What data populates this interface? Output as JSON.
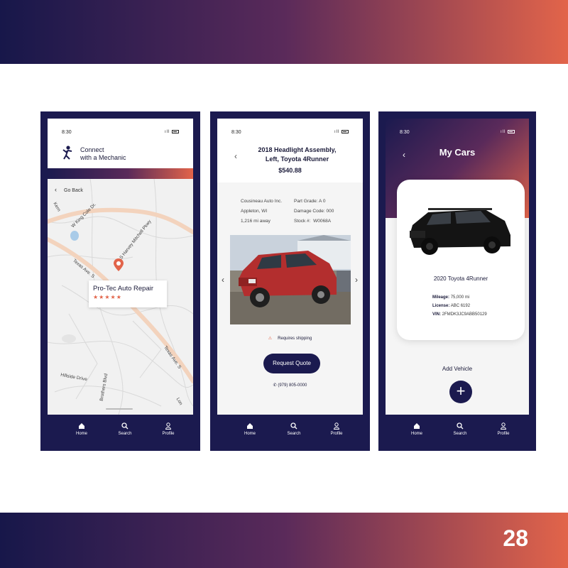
{
  "slide": {
    "page_number": "28"
  },
  "colors": {
    "navy": "#1b1a4f",
    "accent": "#e2644a",
    "star": "#e2644a"
  },
  "status_bar": {
    "time": "8:30"
  },
  "nav": {
    "home": "Home",
    "search": "Search",
    "profile": "Profile"
  },
  "screen1": {
    "title_line1": "Connect",
    "title_line2": "with a Mechanic",
    "go_back": "Go Back",
    "streets": [
      "W King Cole Dr.",
      "S Harvey Mitchell Pkwy",
      "Texas Ave. S",
      "Texas Ave. S",
      "Hillside Drive",
      "Brothers Blvd",
      "Kern",
      "Lon"
    ],
    "place_name": "Pro-Tec Auto Repair",
    "rating_stars": "★★★★★",
    "rating": 5
  },
  "screen2": {
    "title_line1": "2018 Headlight Assembly,",
    "title_line2": "Left, Toyota 4Runner",
    "price": "$540.88",
    "seller": "Cousineau Auto Inc.",
    "location": "Appleton, WI",
    "distance": "1,216 mi away",
    "part_grade": "Part Grade: A 0",
    "damage_code": "Damage Code: 000",
    "stock_label": "Stock #:",
    "stock_value": "W0068A",
    "shipping": "Requires shipping",
    "request_button": "Request Quote",
    "phone": "(979) 805-0000"
  },
  "screen3": {
    "title": "My Cars",
    "car_name": "2020 Toyota 4Runner",
    "mileage_label": "Mileage:",
    "mileage_value": "75,000 mi",
    "license_label": "License:",
    "license_value": "ABC 6192",
    "vin_label": "VIN:",
    "vin_value": "2FMDK3JC9ABB50129",
    "add_vehicle": "Add Vehicle",
    "add_icon": "+"
  }
}
